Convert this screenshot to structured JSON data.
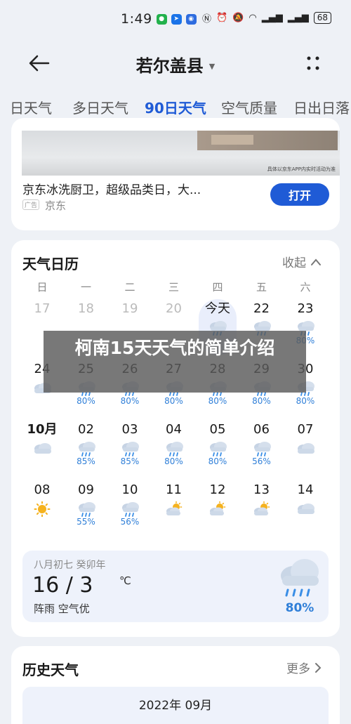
{
  "status_bar": {
    "time": "1:49",
    "battery": "68"
  },
  "header": {
    "title": "若尔盖县"
  },
  "tabs": [
    "日天气",
    "多日天气",
    "90日天气",
    "空气质量",
    "日出日落"
  ],
  "ad": {
    "title": "京东冰洗厨卫，超级品类日，大...",
    "badge": "广告",
    "source": "京东",
    "button": "打开",
    "image_caption": "具体以京东APP内实时活动为准"
  },
  "calendar": {
    "title": "天气日历",
    "collapse_label": "收起",
    "weekdays": [
      "日",
      "一",
      "二",
      "三",
      "四",
      "五",
      "六"
    ],
    "rows": [
      [
        {
          "d": "17",
          "past": true
        },
        {
          "d": "18",
          "past": true
        },
        {
          "d": "19",
          "past": true
        },
        {
          "d": "20",
          "past": true
        },
        {
          "d": "今天",
          "today": true,
          "icon": "rain",
          "pct": ""
        },
        {
          "d": "22",
          "icon": "rain",
          "pct": ""
        },
        {
          "d": "23",
          "icon": "rain",
          "pct": "80%"
        }
      ],
      [
        {
          "d": "24",
          "icon": "cloud",
          "pct": ""
        },
        {
          "d": "25",
          "icon": "rain",
          "pct": "80%"
        },
        {
          "d": "26",
          "icon": "rain",
          "pct": "80%"
        },
        {
          "d": "27",
          "icon": "rain",
          "pct": "80%"
        },
        {
          "d": "28",
          "icon": "rain",
          "pct": "80%"
        },
        {
          "d": "29",
          "icon": "rain",
          "pct": "80%"
        },
        {
          "d": "30",
          "icon": "rain",
          "pct": "80%"
        }
      ],
      [
        {
          "d": "10月",
          "month": true,
          "icon": "cloud",
          "pct": ""
        },
        {
          "d": "02",
          "icon": "rain",
          "pct": "85%"
        },
        {
          "d": "03",
          "icon": "rain",
          "pct": "85%"
        },
        {
          "d": "04",
          "icon": "rain",
          "pct": "80%"
        },
        {
          "d": "05",
          "icon": "rain",
          "pct": "80%"
        },
        {
          "d": "06",
          "icon": "rain",
          "pct": "56%"
        },
        {
          "d": "07",
          "icon": "cloud",
          "pct": ""
        }
      ],
      [
        {
          "d": "08",
          "icon": "sun",
          "pct": ""
        },
        {
          "d": "09",
          "icon": "rain",
          "pct": "55%"
        },
        {
          "d": "10",
          "icon": "rain",
          "pct": "56%"
        },
        {
          "d": "11",
          "icon": "partly",
          "pct": ""
        },
        {
          "d": "12",
          "icon": "partly",
          "pct": ""
        },
        {
          "d": "13",
          "icon": "partly",
          "pct": ""
        },
        {
          "d": "14",
          "icon": "cloud",
          "pct": ""
        }
      ]
    ],
    "detail": {
      "lunar": "八月初七 癸卯年",
      "temp": "16 / 3",
      "unit": "℃",
      "desc": "阵雨 空气优",
      "pct": "80%"
    }
  },
  "history": {
    "title": "历史天气",
    "more_label": "更多",
    "month": "2022年 09月"
  },
  "overlay": {
    "text": "柯南15天天气的简单介绍"
  },
  "colors": {
    "accent": "#1f5bd6",
    "rain_pct": "#2f7fd8",
    "background": "#eef1f6"
  }
}
